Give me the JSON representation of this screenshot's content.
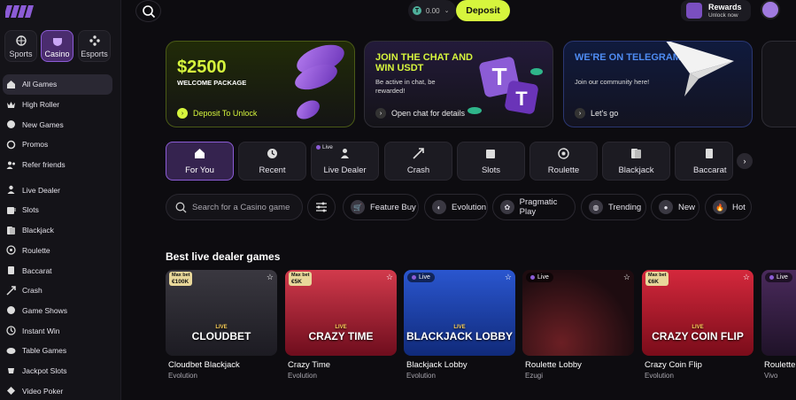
{
  "sidebar": {
    "segments": [
      {
        "label": "Sports",
        "icon": "sports-icon"
      },
      {
        "label": "Casino",
        "icon": "casino-icon",
        "active": true
      },
      {
        "label": "Esports",
        "icon": "esports-icon"
      }
    ],
    "items": [
      {
        "label": "All Games",
        "icon": "home-icon"
      },
      {
        "label": "High Roller",
        "icon": "crown-icon"
      },
      {
        "label": "New Games",
        "icon": "new-icon"
      },
      {
        "label": "Promos",
        "icon": "promo-icon"
      },
      {
        "label": "Refer friends",
        "icon": "users-icon"
      },
      {
        "label": "Live Dealer",
        "icon": "dealer-icon"
      },
      {
        "label": "Slots",
        "icon": "slots-icon"
      },
      {
        "label": "Blackjack",
        "icon": "blackjack-icon"
      },
      {
        "label": "Roulette",
        "icon": "roulette-icon"
      },
      {
        "label": "Baccarat",
        "icon": "baccarat-icon"
      },
      {
        "label": "Crash",
        "icon": "crash-icon"
      },
      {
        "label": "Game Shows",
        "icon": "gameshows-icon"
      },
      {
        "label": "Instant Win",
        "icon": "instantwin-icon"
      },
      {
        "label": "Table Games",
        "icon": "tablegames-icon"
      },
      {
        "label": "Jackpot Slots",
        "icon": "jackpot-icon"
      },
      {
        "label": "Video Poker",
        "icon": "poker-icon"
      }
    ]
  },
  "header": {
    "balance": "0.00",
    "deposit_label": "Deposit",
    "rewards_title": "Rewards",
    "rewards_sub": "Unlock now"
  },
  "promos": [
    {
      "big": "$2500",
      "sub": "WELCOME PACKAGE",
      "cta": "Deposit To Unlock"
    },
    {
      "head": "JOIN THE CHAT AND WIN USDT",
      "desc": "Be active in chat, be rewarded!",
      "cta": "Open chat for details"
    },
    {
      "head": "WE'RE ON TELEGRAM",
      "desc": "Join our community here!",
      "cta": "Let's go"
    }
  ],
  "categories": [
    {
      "label": "For You",
      "icon": "home-icon",
      "active": true
    },
    {
      "label": "Recent",
      "icon": "clock-icon"
    },
    {
      "label": "Live Dealer",
      "icon": "dealer-icon",
      "live": "Live"
    },
    {
      "label": "Crash",
      "icon": "crash-icon"
    },
    {
      "label": "Slots",
      "icon": "slots-icon"
    },
    {
      "label": "Roulette",
      "icon": "roulette-icon"
    },
    {
      "label": "Blackjack",
      "icon": "blackjack-icon"
    },
    {
      "label": "Baccarat",
      "icon": "baccarat-icon"
    }
  ],
  "search": {
    "placeholder": "Search for a Casino game"
  },
  "providers": [
    {
      "label": "Feature Buy",
      "icon": "featurebuy-icon"
    },
    {
      "label": "Evolution",
      "icon": "evolution-icon"
    },
    {
      "label": "Pragmatic Play",
      "icon": "pragmatic-icon"
    },
    {
      "label": "Trending",
      "icon": "trending-icon"
    },
    {
      "label": "New",
      "icon": "new-icon"
    },
    {
      "label": "Hot",
      "icon": "fire-icon"
    }
  ],
  "section_title": "Best live dealer games",
  "games": [
    {
      "title": "Cloudbet Blackjack",
      "provider": "Evolution",
      "maxbet_label": "Max bet",
      "maxbet": "€100K",
      "art": "CLOUDBET",
      "art_small": "LIVE",
      "bg": "#2c2a30"
    },
    {
      "title": "Crazy Time",
      "provider": "Evolution",
      "maxbet_label": "Max bet",
      "maxbet": "€5K",
      "art": "CRAZY TIME",
      "art_small": "LIVE",
      "bg": "#a3172f"
    },
    {
      "title": "Blackjack Lobby",
      "provider": "Evolution",
      "live": "Live",
      "art": "BLACKJACK LOBBY",
      "art_small": "LIVE",
      "bg": "#1b3ea8"
    },
    {
      "title": "Roulette Lobby",
      "provider": "Ezugi",
      "live": "Live",
      "art": "",
      "art_small": "",
      "bg": "#2a1216"
    },
    {
      "title": "Crazy Coin Flip",
      "provider": "Evolution",
      "maxbet_label": "Max bet",
      "maxbet": "€6K",
      "art": "CRAZY COIN FLIP",
      "art_small": "LIVE",
      "bg": "#b0142a"
    },
    {
      "title": "Roulette",
      "provider": "Vivo",
      "live": "Live",
      "art": "",
      "art_small": "",
      "bg": "#3a1f4a"
    }
  ]
}
